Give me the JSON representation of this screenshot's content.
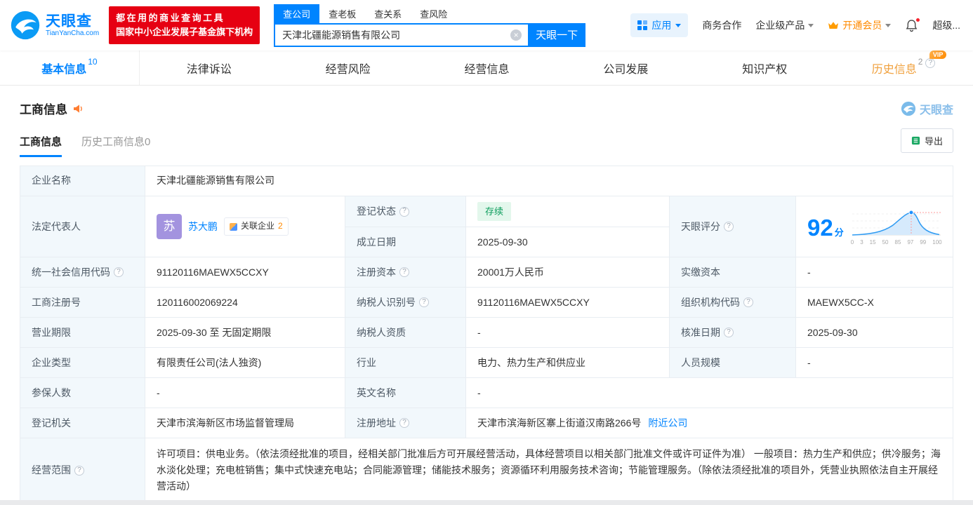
{
  "colors": {
    "brand_blue": "#0084ff",
    "promo_red": "#e60012",
    "vip_orange": "#ff8a00",
    "status_green": "#0c9d5c",
    "label_cell_bg": "#f2f8fc"
  },
  "glyphs": {
    "help": "?",
    "clear": "×"
  },
  "header": {
    "logo": {
      "brand": "天眼查",
      "domain": "TianYanCha.com"
    },
    "promo": {
      "line1": "都在用的商业查询工具",
      "line2": "国家中小企业发展子基金旗下机构"
    },
    "search": {
      "tabs": [
        "查公司",
        "查老板",
        "查关系",
        "查风险"
      ],
      "value": "天津北疆能源销售有限公司",
      "button_label": "天眼一下"
    },
    "menu": {
      "apps": "应用",
      "business": "商务合作",
      "enterprise": "企业级产品",
      "vip": "开通会员",
      "super": "超级..."
    }
  },
  "main_tabs": [
    {
      "label": "基本信息",
      "count": "10"
    },
    {
      "label": "法律诉讼"
    },
    {
      "label": "经营风险"
    },
    {
      "label": "经营信息"
    },
    {
      "label": "公司发展"
    },
    {
      "label": "知识产权"
    },
    {
      "label": "历史信息",
      "count": "2",
      "badge": "VIP"
    }
  ],
  "section": {
    "title": "工商信息",
    "watermark": "天眼查",
    "subtab_active": "工商信息",
    "subtab_history": "历史工商信息0",
    "export_label": "导出"
  },
  "biz": {
    "company_name_label": "企业名称",
    "company_name": "天津北疆能源销售有限公司",
    "legal_rep_label": "法定代表人",
    "legal_rep_avatar_char": "苏",
    "legal_rep_name": "苏大鹏",
    "related_tag": "关联企业",
    "related_count": "2",
    "reg_status_label": "登记状态",
    "reg_status": "存续",
    "establish_label": "成立日期",
    "establish_date": "2025-09-30",
    "score_label": "天眼评分",
    "score_value": "92",
    "score_unit": "分",
    "score_axis": [
      "0",
      "3",
      "15",
      "50",
      "85",
      "97",
      "99",
      "100"
    ],
    "credit_code_label": "统一社会信用代码",
    "credit_code": "91120116MAEWX5CCXY",
    "reg_capital_label": "注册资本",
    "reg_capital": "20001万人民币",
    "paid_capital_label": "实缴资本",
    "paid_capital": "-",
    "reg_number_label": "工商注册号",
    "reg_number": "120116002069224",
    "taxpayer_id_label": "纳税人识别号",
    "taxpayer_id": "91120116MAEWX5CCXY",
    "org_code_label": "组织机构代码",
    "org_code": "MAEWX5CC-X",
    "business_term_label": "营业期限",
    "business_term": "2025-09-30 至 无固定期限",
    "taxpayer_quality_label": "纳税人资质",
    "taxpayer_quality": "-",
    "approval_date_label": "核准日期",
    "approval_date": "2025-09-30",
    "company_type_label": "企业类型",
    "company_type": "有限责任公司(法人独资)",
    "industry_label": "行业",
    "industry": "电力、热力生产和供应业",
    "staff_size_label": "人员规模",
    "staff_size": "-",
    "insured_label": "参保人数",
    "insured": "-",
    "english_name_label": "英文名称",
    "english_name": "-",
    "reg_authority_label": "登记机关",
    "reg_authority": "天津市滨海新区市场监督管理局",
    "reg_address_label": "注册地址",
    "reg_address": "天津市滨海新区寨上街道汉南路266号",
    "nearby_link": "附近公司",
    "business_scope_label": "经营范围",
    "business_scope": "许可项目：供电业务。（依法须经批准的项目，经相关部门批准后方可开展经营活动，具体经营项目以相关部门批准文件或许可证件为准） 一般项目：热力生产和供应；供冷服务；海水淡化处理；充电桩销售；集中式快速充电站；合同能源管理；储能技术服务；资源循环利用服务技术咨询；节能管理服务。（除依法须经批准的项目外，凭营业执照依法自主开展经营活动）"
  }
}
